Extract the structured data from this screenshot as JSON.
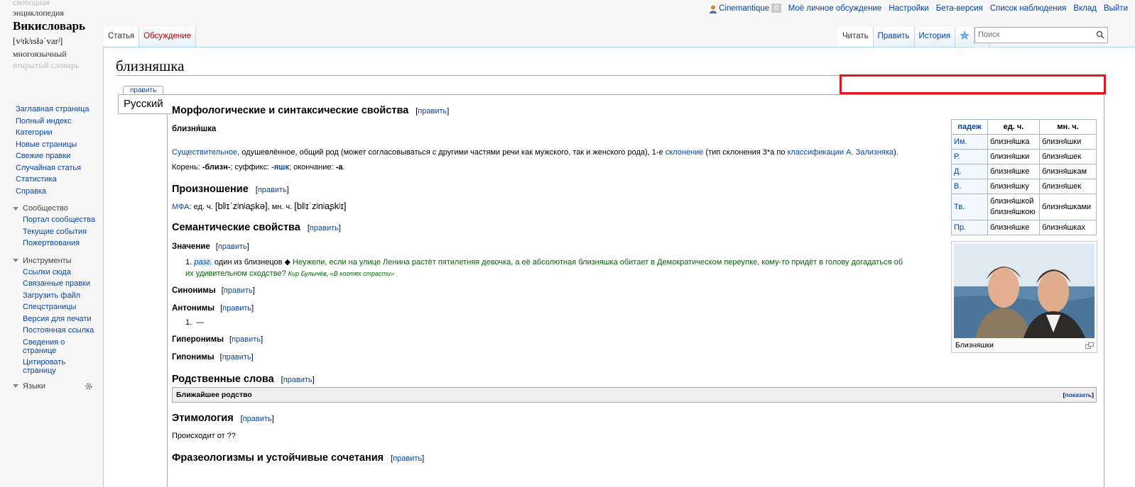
{
  "logo": {
    "line0": "свободная",
    "line1": "энциклопедия",
    "title": "Викисловарь",
    "ipa": "[vʲɪkʲɪsɫəˈvarʲ]",
    "line3": "многоязычный",
    "line4": "открытый словарь"
  },
  "personal": {
    "user": "Cinemantique",
    "count": "0",
    "talk": "Моё личное обсуждение",
    "settings": "Настройки",
    "beta": "Бета-версия",
    "watchlist": "Список наблюдения",
    "contribs": "Вклад",
    "logout": "Выйти"
  },
  "tabs_left": {
    "article": "Статья",
    "discussion": "Обсуждение"
  },
  "tabs_right": {
    "read": "Читать",
    "edit": "Править",
    "history": "История"
  },
  "search": {
    "placeholder": "Поиск"
  },
  "sidebar": {
    "nav": [
      "Заглавная страница",
      "Полный индекс",
      "Категории",
      "Новые страницы",
      "Свежие правки",
      "Случайная статья",
      "Статистика",
      "Справка"
    ],
    "community_head": "Сообщество",
    "community": [
      "Портал сообщества",
      "Текущие события",
      "Пожертвования"
    ],
    "tools_head": "Инструменты",
    "tools": [
      "Ссылки сюда",
      "Связанные правки",
      "Загрузить файл",
      "Спецстраницы",
      "Версия для печати",
      "Постоянная ссылка",
      "Сведения о странице",
      "Цитировать страницу"
    ],
    "langs_head": "Языки"
  },
  "page": {
    "title": "близняшка",
    "edit_link": "править",
    "lang_tab": "Русский"
  },
  "morph": {
    "heading": "Морфологические и синтаксические свойства",
    "word": "близня́шка",
    "pos": "Существительное",
    "desc": ", одушевлённое, общий род (может согласовываться с другими частями речи как мужского, так и женского рода), 1-е ",
    "decl_link": "склонение",
    "decl_mid": " (тип склонения 3*a по ",
    "class_link": "классификации А. Зализняка",
    "decl_end": ").",
    "root_label": "Корень: ",
    "root": "-близн-",
    "suffix_label": "; суффикс: ",
    "suffix": "-яшк",
    "ending_label": "; окончание: ",
    "ending": "-а",
    "ending_end": "."
  },
  "pron": {
    "heading": "Произношение",
    "mfa": "МФА",
    "sg_label": ": ед. ч. ",
    "sg": "[blʲɪˈzʲnʲaʂkə]",
    "pl_label": ", мн. ч. ",
    "pl": "[blʲɪˈzʲnʲaʂkʲɪ]"
  },
  "sem": {
    "heading": "Семантические свойства",
    "meaning_head": "Значение",
    "m1_num": "1.",
    "m1_label": "разг.",
    "m1_text": " один из близнецов ◆ ",
    "m1_example": "Неужели, если на улице Ленина растёт пятилетняя девочка, а её абсолютная близняшка обитает в Демократическом переулке, кому-то придёт в голову догадаться об их удивительном сходстве?",
    "m1_source": "Кир Булычёв, «В когтях страсти»",
    "syn_head": "Синонимы",
    "ant_head": "Антонимы",
    "ant1_num": "1.",
    "ant1": "—",
    "hyper_head": "Гиперонимы",
    "hypo_head": "Гипонимы"
  },
  "related": {
    "heading": "Родственные слова",
    "box_title": "Ближайшее родство",
    "show": "показать"
  },
  "etym": {
    "heading": "Этимология",
    "text": "Происходит от ??"
  },
  "phraseo": {
    "heading": "Фразеологизмы и устойчивые сочетания"
  },
  "decl_table": {
    "h_case": "падеж",
    "h_sg": "ед. ч.",
    "h_pl": "мн. ч.",
    "rows": [
      {
        "case": "Им.",
        "sg": "близня́шка",
        "pl": "близня́шки"
      },
      {
        "case": "Р.",
        "sg": "близня́шки",
        "pl": "близня́шек"
      },
      {
        "case": "Д.",
        "sg": "близня́шке",
        "pl": "близня́шкам"
      },
      {
        "case": "В.",
        "sg": "близня́шку",
        "pl": "близня́шек"
      },
      {
        "case": "Тв.",
        "sg": "близня́шкой\nблизня́шкою",
        "pl": "близня́шками"
      },
      {
        "case": "Пр.",
        "sg": "близня́шке",
        "pl": "близня́шках"
      }
    ]
  },
  "image": {
    "caption": "Близняшки"
  },
  "colors": {
    "link": "#0645ad",
    "redlink": "#ba0000",
    "example": "#006400",
    "highlight": "#e0151e"
  }
}
